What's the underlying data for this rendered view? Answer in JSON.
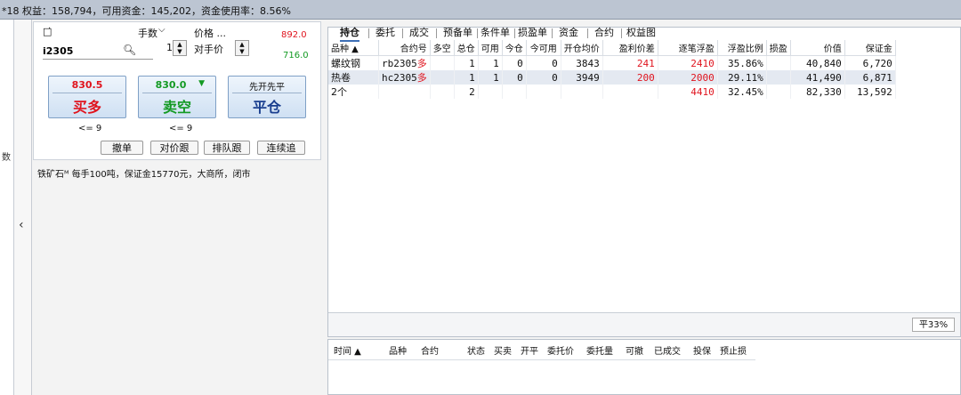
{
  "account_bar": {
    "text": "*18  权益：158,794，可用资金：145,202，资金使用率：8.56%"
  },
  "left_fragments": {
    "item1": "数"
  },
  "order_panel": {
    "symbol": "i2305",
    "qty_label": "手数",
    "qty_value": "1",
    "price_label": "价格 ...",
    "price_value": "对手价",
    "upper_limit": "892.0",
    "lower_limit": "716.0",
    "buy_btn": {
      "price": "830.5",
      "label": "买多"
    },
    "sell_btn": {
      "price": "830.0",
      "label": "卖空"
    },
    "close_btn": {
      "price": "先开先平",
      "label": "平仓"
    },
    "buy_avail": "<= 9",
    "sell_avail": "<= 9",
    "btn_cancel": "撤单",
    "btn_opp": "对价跟",
    "btn_queue": "排队跟",
    "btn_chase": "连续追"
  },
  "contract_info": "铁矿石ᴹ  每手100吨，保证金15770元，大商所，闭市",
  "tabs": [
    "持仓",
    "委托",
    "成交",
    "预备单",
    "条件单",
    "损盈单",
    "资金",
    "合约",
    "权益图"
  ],
  "positions": {
    "columns": [
      "品种 ▲",
      "合约号",
      "多空",
      "总仓",
      "可用",
      "今仓",
      "今可用",
      "开仓均价",
      "盈利价差",
      "逐笔浮盈",
      "浮盈比例",
      "损盈",
      "价值",
      "保证金"
    ],
    "rows": [
      {
        "name": "螺纹钢",
        "contract": "rb2305",
        "side": "多",
        "total": "1",
        "avail": "1",
        "today": "0",
        "today_avail": "0",
        "open_avg": "3843",
        "spread": "241",
        "float_pnl": "2410",
        "ratio": "35.86%",
        "sl": "",
        "value": "40,840",
        "margin": "6,720"
      },
      {
        "name": "热卷",
        "contract": "hc2305",
        "side": "多",
        "total": "1",
        "avail": "1",
        "today": "0",
        "today_avail": "0",
        "open_avg": "3949",
        "spread": "200",
        "float_pnl": "2000",
        "ratio": "29.11%",
        "sl": "",
        "value": "41,490",
        "margin": "6,871"
      }
    ],
    "summary": {
      "name": "2个",
      "total": "2",
      "float_pnl": "4410",
      "ratio": "32.45%",
      "value": "82,330",
      "margin": "13,592"
    },
    "ratio_button": "平33%"
  },
  "order_list": {
    "columns": [
      "时间 ▲",
      "品种",
      "合约",
      "状态",
      "买卖",
      "开平",
      "委托价",
      "委托量",
      "可撤",
      "已成交",
      "投保",
      "预止损"
    ]
  },
  "colors": {
    "up": "#e0141e",
    "down": "#139a23",
    "topbar": "#bcc5d2"
  }
}
